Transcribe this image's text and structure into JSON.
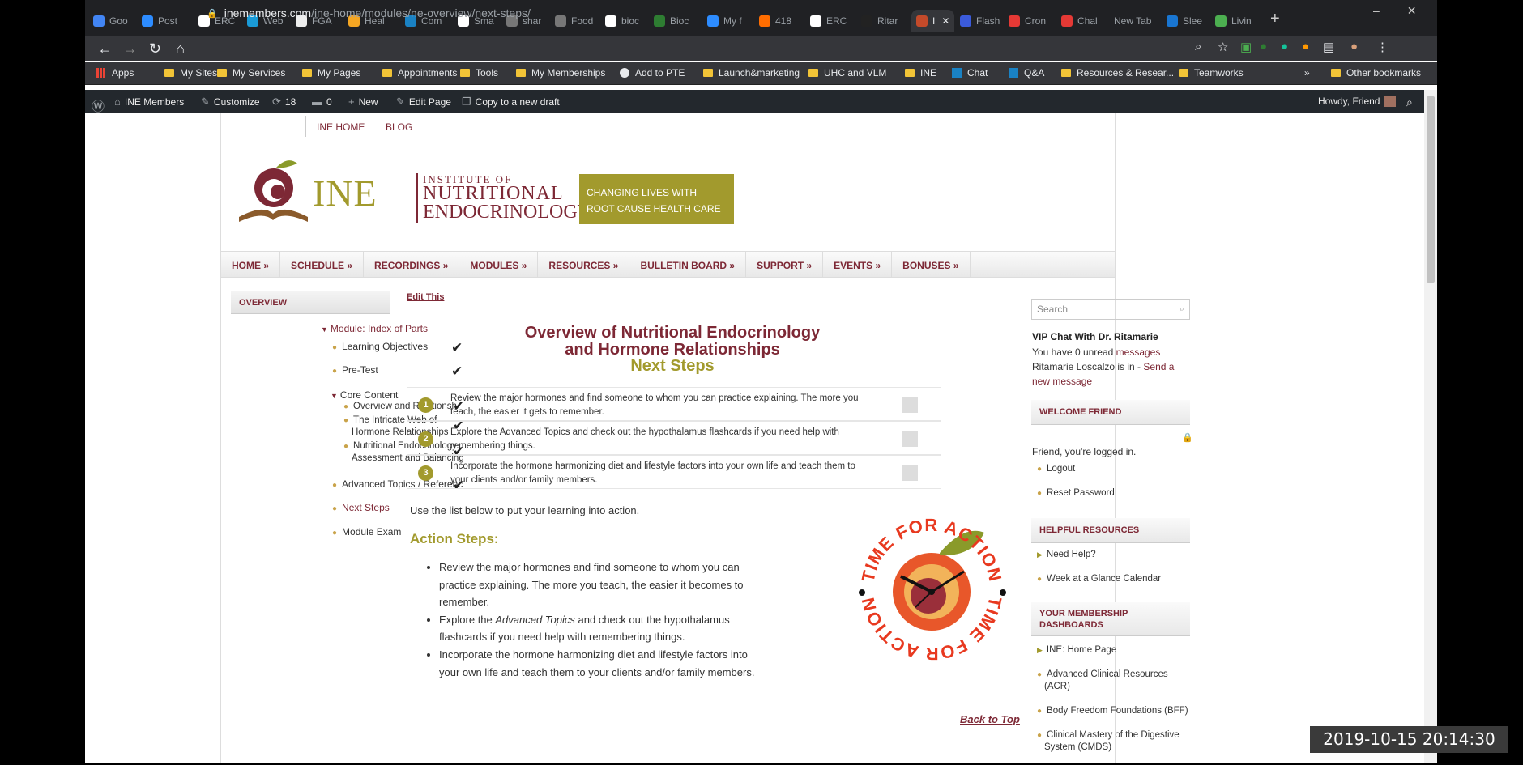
{
  "tabs": [
    {
      "label": "Goo",
      "color": "#4285f4"
    },
    {
      "label": "Post",
      "color": "#2d8cff"
    },
    {
      "label": "ERC",
      "color": "#ffffff"
    },
    {
      "label": "Web",
      "color": "#1a9bd7"
    },
    {
      "label": "FGA",
      "color": "#eeeeee"
    },
    {
      "label": "Heal",
      "color": "#f5a623"
    },
    {
      "label": "Com",
      "color": "#1a82c4"
    },
    {
      "label": "Sma",
      "color": "#ffffff"
    },
    {
      "label": "shar",
      "color": "#777777"
    },
    {
      "label": "Food",
      "color": "#777777"
    },
    {
      "label": "bioc",
      "color": "#ffffff"
    },
    {
      "label": "Bioc",
      "color": "#2e7d32"
    },
    {
      "label": "My f",
      "color": "#2d8cff"
    },
    {
      "label": "418",
      "color": "#ff6d00"
    },
    {
      "label": "ERC",
      "color": "#ffffff"
    },
    {
      "label": "Ritar",
      "color": "#222222"
    },
    {
      "label": "I",
      "color": "#c44a2a"
    },
    {
      "label": "Flash",
      "color": "#3b5bdb"
    },
    {
      "label": "Cron",
      "color": "#e53935"
    },
    {
      "label": "Chal",
      "color": "#e53935"
    },
    {
      "label": "New Tab",
      "color": ""
    },
    {
      "label": "Slee",
      "color": "#1976d2"
    },
    {
      "label": "Livin",
      "color": "#4caf50"
    }
  ],
  "address": {
    "host": "inemembers.com",
    "path": "/ine-home/modules/ne-overview/next-steps/"
  },
  "bookmarks": [
    "Apps",
    "My Sites",
    "My Services",
    "My Pages",
    "Appointments",
    "Tools",
    "My Memberships",
    "Add to PTE",
    "Launch&marketing",
    "UHC and VLM",
    "INE",
    "Chat",
    "Q&A",
    "Resources & Resear...",
    "Teamworks",
    "»",
    "Other bookmarks"
  ],
  "wpbar": {
    "site": "INE Members",
    "customize": "Customize",
    "updates": "18",
    "comments": "0",
    "new": "New",
    "edit": "Edit Page",
    "copy": "Copy to a new draft",
    "howdy": "Howdy, Friend"
  },
  "toplinks": {
    "home": "INE HOME",
    "blog": "BLOG"
  },
  "logo": {
    "ine": "INE",
    "line1": "INSTITUTE OF",
    "line2": "NUTRITIONAL",
    "line3": "ENDOCRINOLOGY"
  },
  "banner": {
    "line1": "CHANGING LIVES WITH",
    "line2": "ROOT CAUSE HEALTH CARE"
  },
  "nav": [
    "HOME »",
    "SCHEDULE »",
    "RECORDINGS »",
    "MODULES »",
    "RESOURCES »",
    "BULLETIN BOARD »",
    "SUPPORT »",
    "EVENTS »",
    "BONUSES »"
  ],
  "sidebar": {
    "heading": "OVERVIEW",
    "module": "Module: Index of Parts",
    "items": {
      "lo": "Learning Objectives",
      "pretest": "Pre-Test",
      "core": "Core Content",
      "c1": "Overview and Relationsh",
      "c2a": "The Intricate Web of",
      "c2b": "Hormone Relationships",
      "c3a": "Nutritional Endocrinology",
      "c3b": "Assessment and Balancing",
      "adv": "Advanced Topics / Referenc",
      "next": "Next Steps",
      "exam": "Module Exam"
    }
  },
  "main": {
    "edit": "Edit This",
    "title1": "Overview of Nutritional Endocrinology",
    "title2": "and Hormone Relationships",
    "title3": "Next Steps",
    "steps": [
      {
        "num": "1",
        "text": "Review the major hormones and find someone to whom you can practice explaining. The more you teach, the easier it gets to remember."
      },
      {
        "num": "2",
        "text": "Explore the Advanced Topics and check out the hypothalamus flashcards if you need help with remembering things."
      },
      {
        "num": "3",
        "text": "Incorporate the hormone harmonizing diet and lifestyle factors into your own life and teach them to your clients and/or family members."
      }
    ],
    "use": "Use the list below to put your learning into action.",
    "action_head": "Action Steps:",
    "a1": "Review the major hormones and find someone to whom you can practice explaining.  The more you teach, the easier it becomes to remember.",
    "a2pre": "Explore the ",
    "a2em": "Advanced Topics",
    "a2post": " and check out the hypothalamus flashcards if you need help with remembering things.",
    "a3": "Incorporate the hormone harmonizing diet and lifestyle factors into your own life and teach them to your clients and/or family members.",
    "tfa": "TIME FOR ACTION",
    "backtop": "Back to Top"
  },
  "right": {
    "search_placeholder": "Search",
    "vip": "VIP Chat With Dr. Ritamarie",
    "unread_pre": "You have 0 unread ",
    "unread_link": "messages",
    "ritamarie": "Ritamarie Loscalzo is in - ",
    "send1": "Send a",
    "send2": "new message",
    "welcome": "WELCOME FRIEND",
    "logged": "Friend, you're logged in.",
    "logout": "Logout",
    "reset": "Reset Password",
    "helpful": "HELPFUL RESOURCES",
    "help1": "Need Help?",
    "help2": "Week at a Glance Calendar",
    "dash1": "YOUR MEMBERSHIP",
    "dash2": "DASHBOARDS",
    "d1": "INE: Home Page",
    "d2a": "Advanced Clinical Resources",
    "d2b": "(ACR)",
    "d3": "Body Freedom Foundations (BFF)",
    "d4a": "Clinical Mastery of the Digestive",
    "d4b": "System (CMDS)"
  },
  "timestamp": "2019-10-15 20:14:30"
}
